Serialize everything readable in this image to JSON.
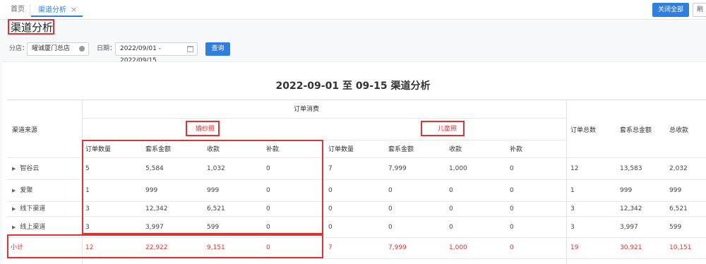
{
  "tabs": {
    "home": "首页",
    "active": "渠道分析",
    "close": "×"
  },
  "actions": {
    "close_all": "关闭全部",
    "refresh": "刷"
  },
  "page": {
    "title": "渠道分析"
  },
  "filters": {
    "store_label": "分店：",
    "store_value": "曜诚厦门总店",
    "date_label": "日期：",
    "date_value": "2022/09/01 - 2022/09/15",
    "query": "查询"
  },
  "report": {
    "title": "2022-09-01 至 09-15 渠道分析",
    "headers": {
      "source": "渠道来源",
      "group": "订单消费",
      "wedding": "婚纱照",
      "child": "儿童照",
      "sub": [
        "订单数量",
        "套系金额",
        "收款",
        "补款"
      ],
      "total_orders": "订单总数",
      "total_amount": "套系总金额",
      "total_received": "总收款"
    },
    "rows": [
      {
        "name": "智谷云",
        "w": [
          "5",
          "5,584",
          "1,032",
          "0"
        ],
        "c": [
          "7",
          "7,999",
          "1,000",
          "0"
        ],
        "t": [
          "12",
          "13,583",
          "2,032"
        ]
      },
      {
        "name": "爱聚",
        "w": [
          "1",
          "999",
          "999",
          "0"
        ],
        "c": [
          "0",
          "0",
          "0",
          "0"
        ],
        "t": [
          "1",
          "999",
          "999"
        ]
      },
      {
        "name": "线下渠道",
        "w": [
          "3",
          "12,342",
          "6,521",
          "0"
        ],
        "c": [
          "0",
          "0",
          "0",
          "0"
        ],
        "t": [
          "3",
          "12,342",
          "6,521"
        ]
      },
      {
        "name": "线上渠道",
        "w": [
          "3",
          "3,997",
          "599",
          "0"
        ],
        "c": [
          "0",
          "0",
          "0",
          "0"
        ],
        "t": [
          "3",
          "3,997",
          "599"
        ]
      }
    ],
    "subtotal": {
      "name": "小计",
      "w": [
        "12",
        "22,922",
        "9,151",
        "0"
      ],
      "c": [
        "7",
        "7,999",
        "1,000",
        "0"
      ],
      "t": [
        "19",
        "30,921",
        "10,151"
      ]
    }
  }
}
